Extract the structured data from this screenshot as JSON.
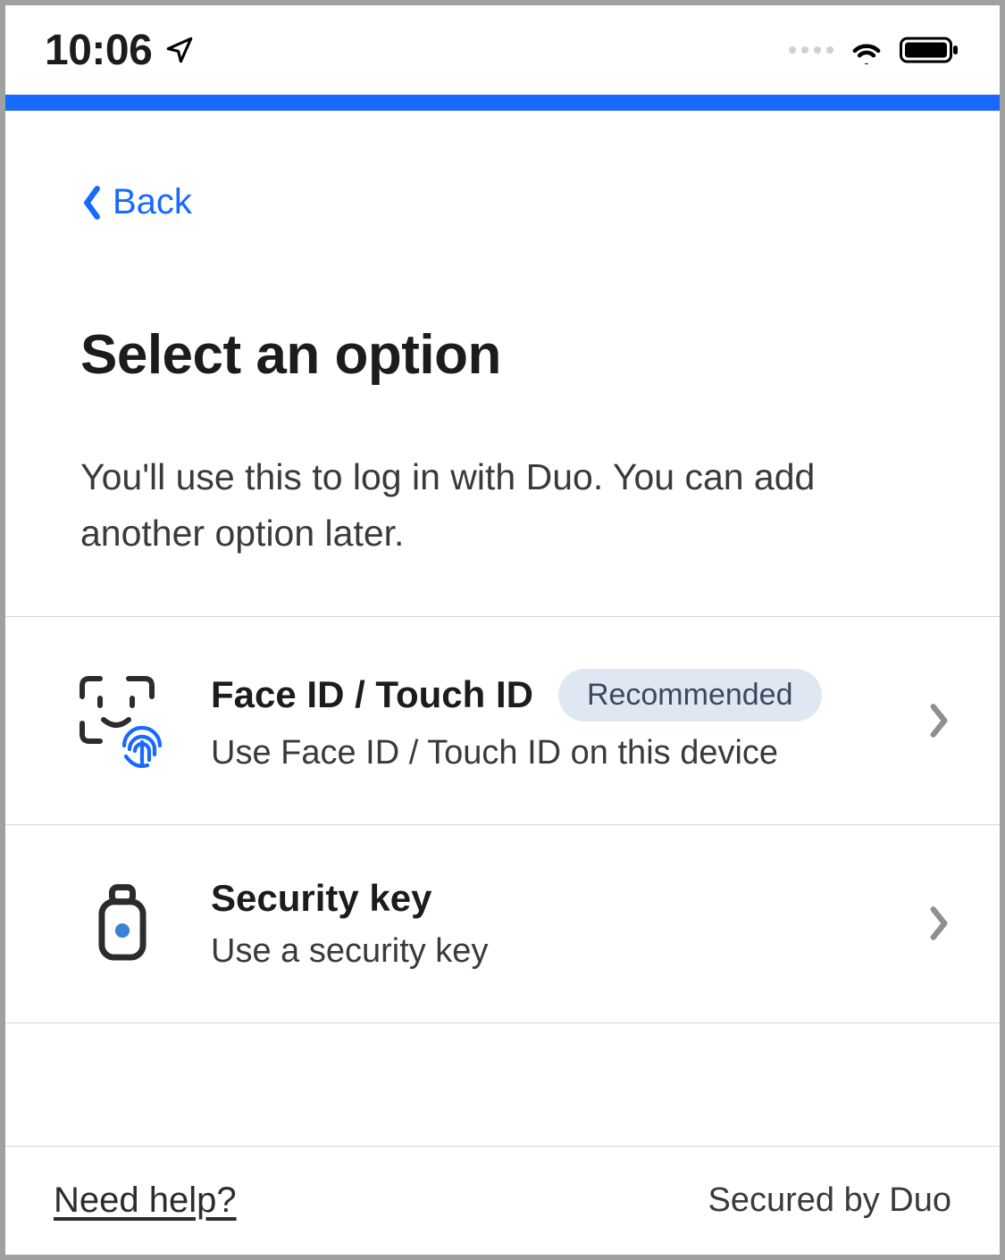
{
  "status": {
    "time": "10:06"
  },
  "accent_color": "#1769ff",
  "back": {
    "label": "Back"
  },
  "title": "Select an option",
  "subtitle": "You'll use this to log in with Duo. You can add another option later.",
  "options": [
    {
      "icon": "face-touch-id-icon",
      "title": "Face ID / Touch ID",
      "badge": "Recommended",
      "description": "Use Face ID / Touch ID on this device"
    },
    {
      "icon": "security-key-icon",
      "title": "Security key",
      "badge": null,
      "description": "Use a security key"
    }
  ],
  "footer": {
    "help": "Need help?",
    "secured": "Secured by Duo"
  }
}
